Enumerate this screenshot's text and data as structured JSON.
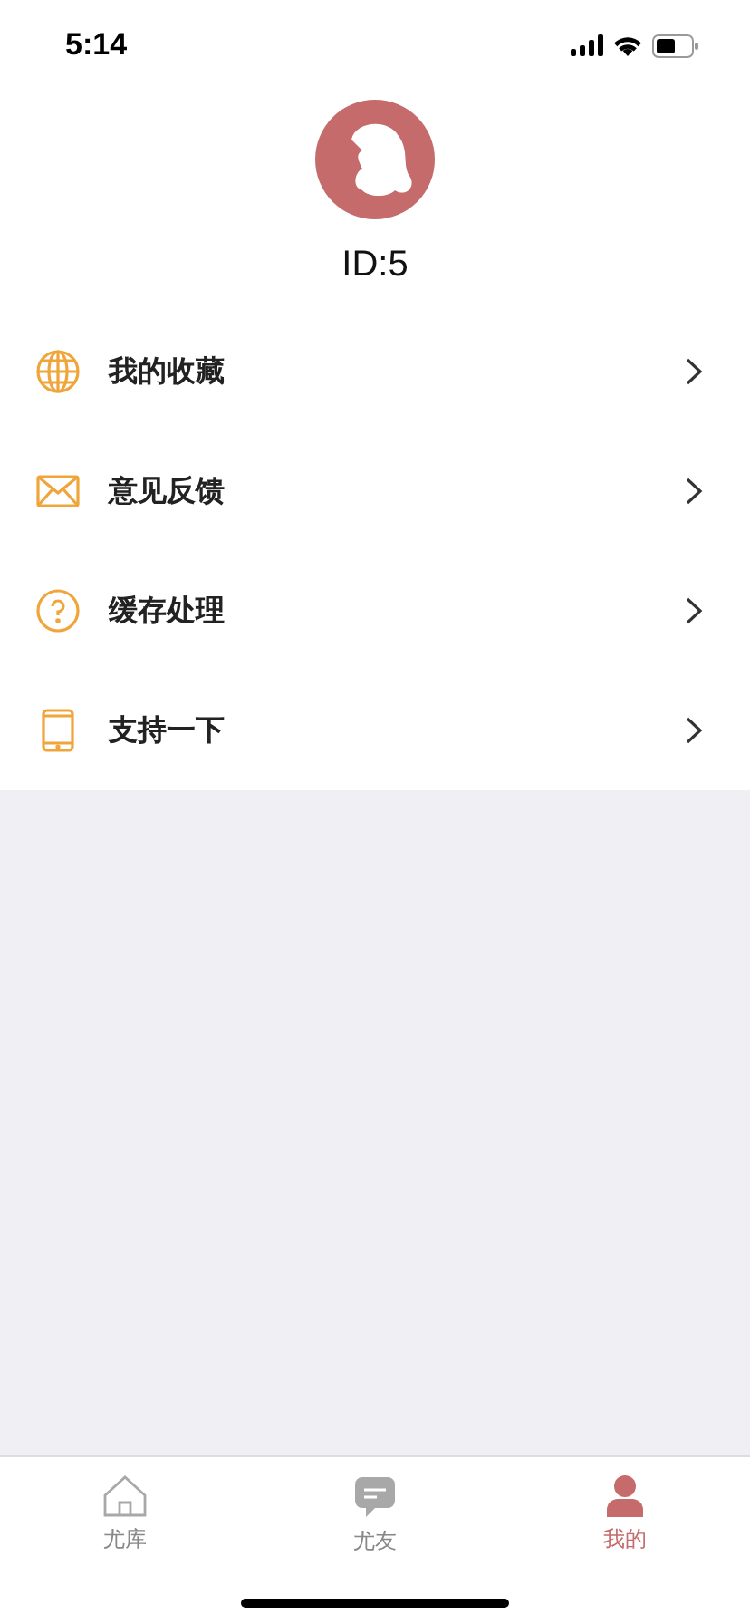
{
  "status_bar": {
    "time": "5:14"
  },
  "profile": {
    "id_label": "ID:5"
  },
  "menu": [
    {
      "kind": "globe",
      "label": "我的收藏"
    },
    {
      "kind": "mail",
      "label": "意见反馈"
    },
    {
      "kind": "help",
      "label": "缓存处理"
    },
    {
      "kind": "tablet",
      "label": "支持一下"
    }
  ],
  "tabs": [
    {
      "kind": "home",
      "label": "尤库",
      "selected": false
    },
    {
      "kind": "chat",
      "label": "尤友",
      "selected": false
    },
    {
      "kind": "person",
      "label": "我的",
      "selected": true
    }
  ]
}
